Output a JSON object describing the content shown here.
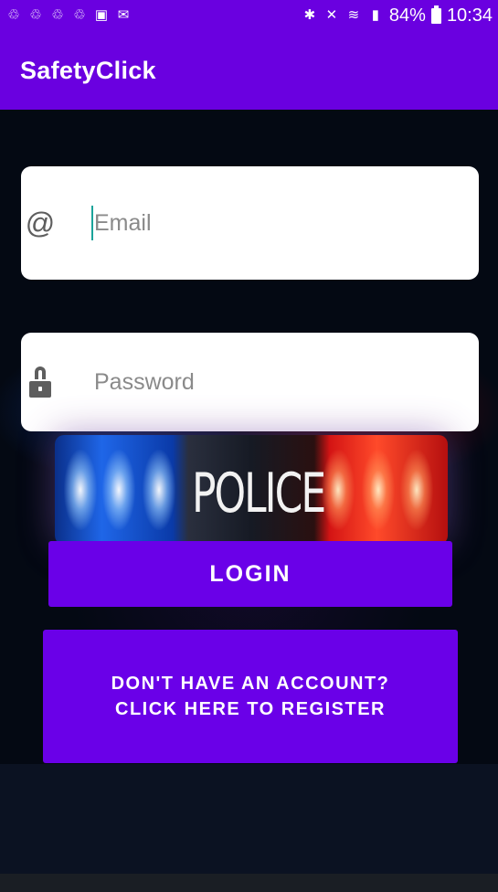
{
  "status_bar": {
    "left_icons": [
      "sync-icon",
      "sync-icon",
      "sync-icon",
      "sync-icon",
      "image-icon",
      "mail-icon"
    ],
    "battery_percent": "84%",
    "time": "10:34"
  },
  "app_bar": {
    "title": "SafetyClick"
  },
  "login_form": {
    "email_placeholder": "Email",
    "password_placeholder": "Password",
    "banner_text": "POLICE",
    "login_label": "LOGIN",
    "register_line1": "DON'T HAVE AN ACCOUNT?",
    "register_line2": "CLICK HERE TO REGISTER"
  },
  "colors": {
    "primary": "#6A00E0",
    "button": "#6A00E8",
    "background": "#040913",
    "caret": "#1AA39A"
  }
}
